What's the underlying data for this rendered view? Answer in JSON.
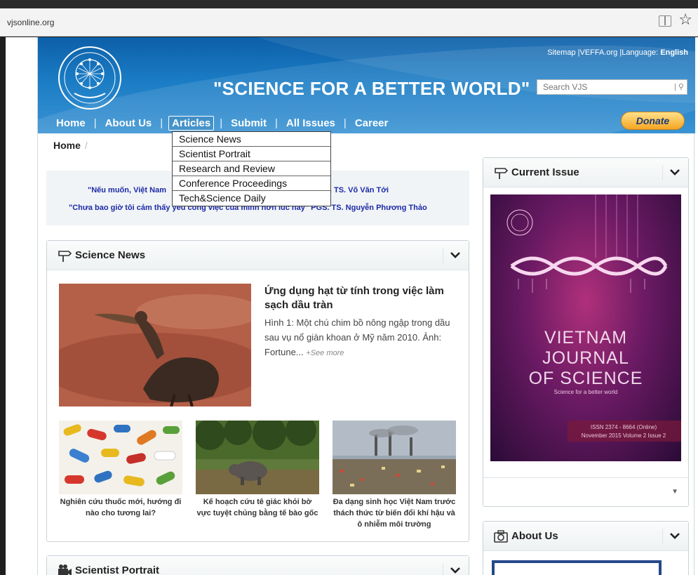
{
  "browser": {
    "url": "vjsonline.org"
  },
  "header": {
    "slogan": "\"SCIENCE FOR A BETTER WORLD\"",
    "toplinks": {
      "sitemap": "Sitemap",
      "veffa": "VEFFA.org",
      "language_label": "Language:",
      "language_value": "English"
    },
    "search_placeholder": "Search VJS",
    "donate": "Donate"
  },
  "nav": {
    "items": [
      {
        "label": "Home"
      },
      {
        "label": "About Us"
      },
      {
        "label": "Articles"
      },
      {
        "label": "Submit"
      },
      {
        "label": "All Issues"
      },
      {
        "label": "Career"
      }
    ],
    "active": "Articles",
    "articles_menu": [
      "Science News",
      "Scientist Portrait",
      "Research and Review",
      "Conference Proceedings",
      "Tech&Science Daily"
    ]
  },
  "breadcrumb": {
    "home": "Home",
    "sep": "/"
  },
  "quotes": {
    "q1_start": "\"Nếu muốn, Việt Nam",
    "q1_end": "ăng\", GS. TS. Võ Văn Tới",
    "q2_start": "\"Chưa bao giờ tôi cảm thấy yêu công việc của mình hơn lúc này\"",
    "q2_end": "PGS. TS. Nguyễn Phương Thảo"
  },
  "science_news": {
    "title": "Science News",
    "featured": {
      "title": "Ứng dụng hạt từ tính trong việc làm sạch dầu tràn",
      "description": "Hình 1: Một chú chim bồ nông ngập trong dầu sau vụ nổ giàn khoan ở Mỹ năm 2010. Ảnh: Fortune...",
      "see_more": "+See more"
    },
    "items": [
      {
        "caption": "Nghiên cứu thuốc mới, hướng đi nào cho tương lai?"
      },
      {
        "caption": "Kế hoạch cứu tê giác khỏi bờ vực tuyệt chủng bằng tế bào gốc"
      },
      {
        "caption": "Đa dạng sinh học Việt Nam trước thách thức từ biến đổi khí hậu và ô nhiễm môi trường"
      }
    ]
  },
  "scientist_portrait": {
    "title": "Scientist Portrait"
  },
  "current_issue": {
    "title": "Current Issue",
    "cover_title": "VIETNAM JOURNAL OF SCIENCE",
    "cover_line1": "VIETNAM",
    "cover_line2": "JOURNAL",
    "cover_line3": "OF SCIENCE",
    "cover_subtitle": "Science for a better world",
    "issn": "ISSN 2374 - 8664 (Online)",
    "issue": "November 2015   Volume 2   Issue 2"
  },
  "about_us": {
    "title": "About Us"
  },
  "colors": {
    "header_blue": "#1a7cc4",
    "quote_blue": "#1b2aa8",
    "donate_gold": "#f5a623",
    "cover_purple": "#6a1a63"
  }
}
